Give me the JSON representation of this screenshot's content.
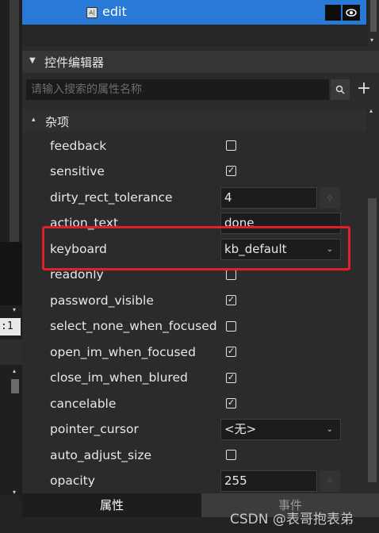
{
  "tree": {
    "selected_item_label": "edit",
    "item_icon_text": "A|"
  },
  "left": {
    "zoom_text": ":1"
  },
  "editor": {
    "title": "控件编辑器"
  },
  "search": {
    "placeholder": "请输入搜索的属性名称"
  },
  "section": {
    "title": "杂项"
  },
  "properties": {
    "feedback": {
      "label": "feedback",
      "checked": false
    },
    "sensitive": {
      "label": "sensitive",
      "checked": true
    },
    "dirty_rect_tolerance": {
      "label": "dirty_rect_tolerance",
      "value": "4"
    },
    "action_text": {
      "label": "action_text",
      "value": "done"
    },
    "keyboard": {
      "label": "keyboard",
      "value": "kb_default"
    },
    "readonly": {
      "label": "readonly",
      "checked": false
    },
    "password_visible": {
      "label": "password_visible",
      "checked": true
    },
    "select_none_when_focused": {
      "label": "select_none_when_focused",
      "checked": false
    },
    "open_im_when_focused": {
      "label": "open_im_when_focused",
      "checked": true
    },
    "close_im_when_blured": {
      "label": "close_im_when_blured",
      "checked": true
    },
    "cancelable": {
      "label": "cancelable",
      "checked": true
    },
    "pointer_cursor": {
      "label": "pointer_cursor",
      "value": "<无>"
    },
    "auto_adjust_size": {
      "label": "auto_adjust_size",
      "checked": false
    },
    "opacity": {
      "label": "opacity",
      "value": "255"
    }
  },
  "tabs": {
    "properties": "属性",
    "events": "事件"
  },
  "watermark": "CSDN @表哥抱表弟",
  "colors": {
    "selection": "#2979d6",
    "highlight": "#e0202a",
    "background": "#2b2b2b"
  },
  "icons": {
    "search": "search-icon",
    "add": "plus-icon",
    "visibility": "eye-icon",
    "spinner": "spinner-icon",
    "dropdown": "chevron-down-icon"
  }
}
